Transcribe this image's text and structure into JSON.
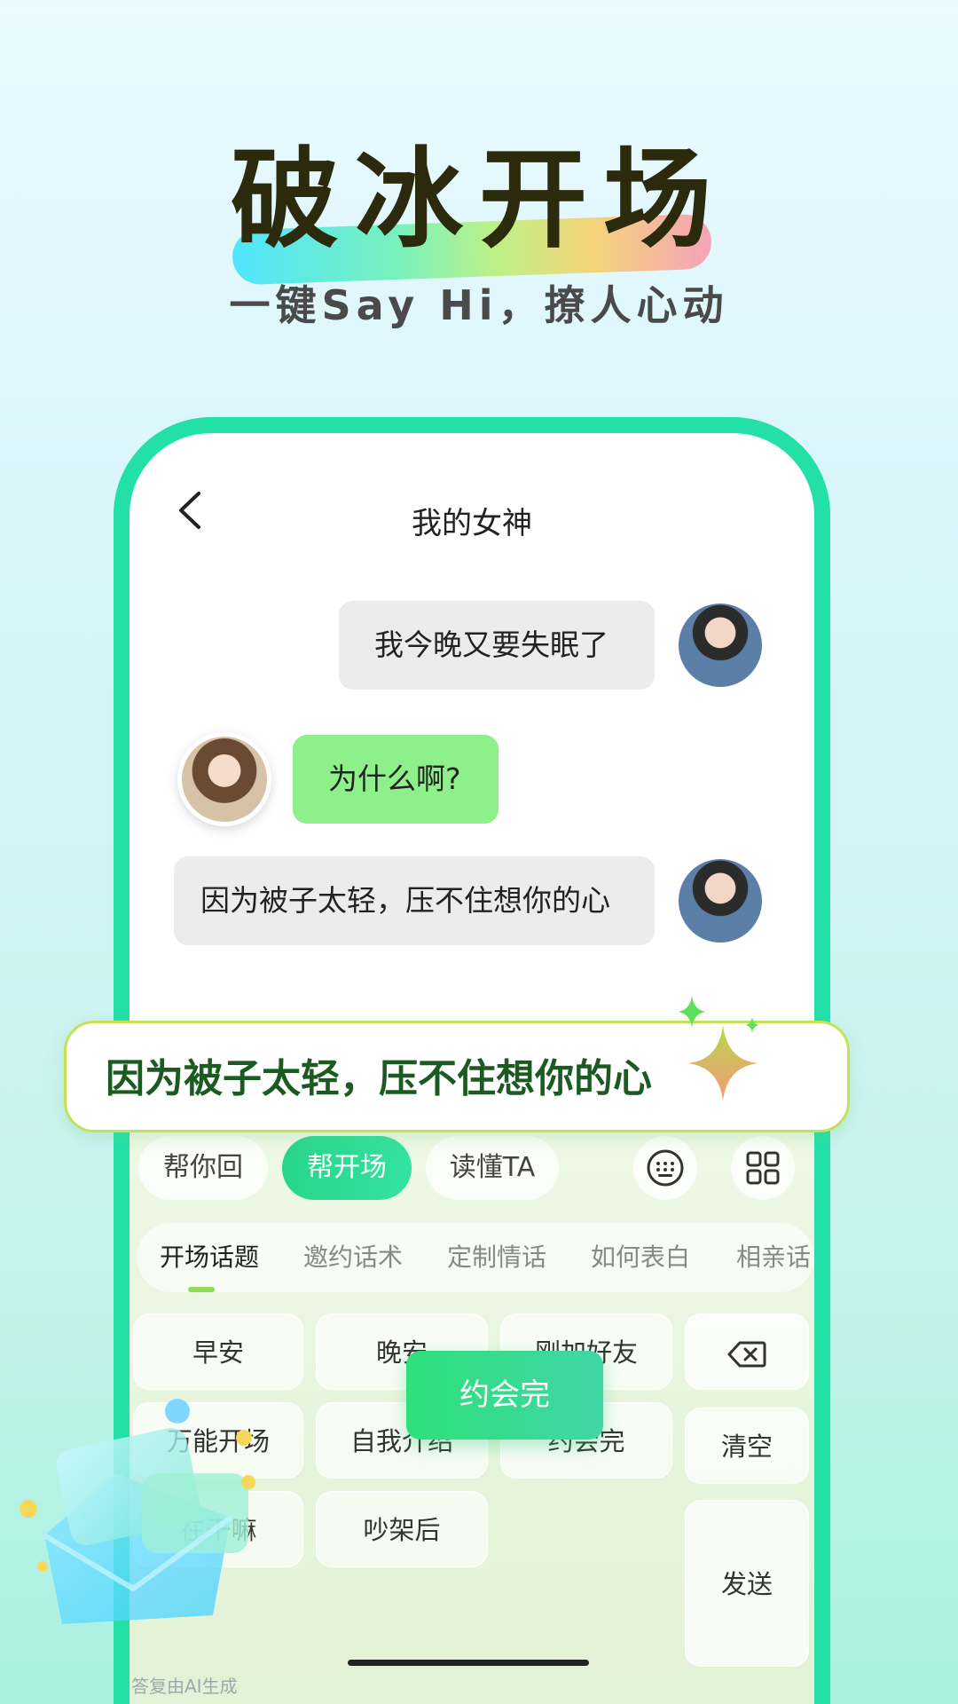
{
  "headline": {
    "title": "破冰开场",
    "subtitle": "一键Say Hi，撩人心动"
  },
  "chat": {
    "title": "我的女神",
    "messages": [
      {
        "side": "right",
        "text": "我今晚又要失眠了"
      },
      {
        "side": "left",
        "text": "为什么啊?"
      },
      {
        "side": "right",
        "text": "因为被子太轻，压不住想你的心"
      }
    ]
  },
  "suggestion": {
    "text": "因为被子太轻，压不住想你的心"
  },
  "toolbar": {
    "modes": [
      "帮你回",
      "帮开场",
      "读懂TA"
    ],
    "active_mode": "帮开场"
  },
  "categories": [
    "开场话题",
    "邀约话术",
    "定制情话",
    "如何表白",
    "相亲话"
  ],
  "phrases": [
    "早安",
    "晚安",
    "刚加好友",
    "万能开场",
    "自我介绍",
    "约会完",
    "在干嘛",
    "吵架后"
  ],
  "side_keys": {
    "clear": "清空",
    "send": "发送"
  },
  "overlay_button": "约会完",
  "footer_note": "答复由AI生成",
  "colors": {
    "accent": "#22e0a8",
    "send_bubble": "#ececec",
    "receive_bubble": "#8ef08a",
    "suggest_text": "#1b5a20"
  }
}
